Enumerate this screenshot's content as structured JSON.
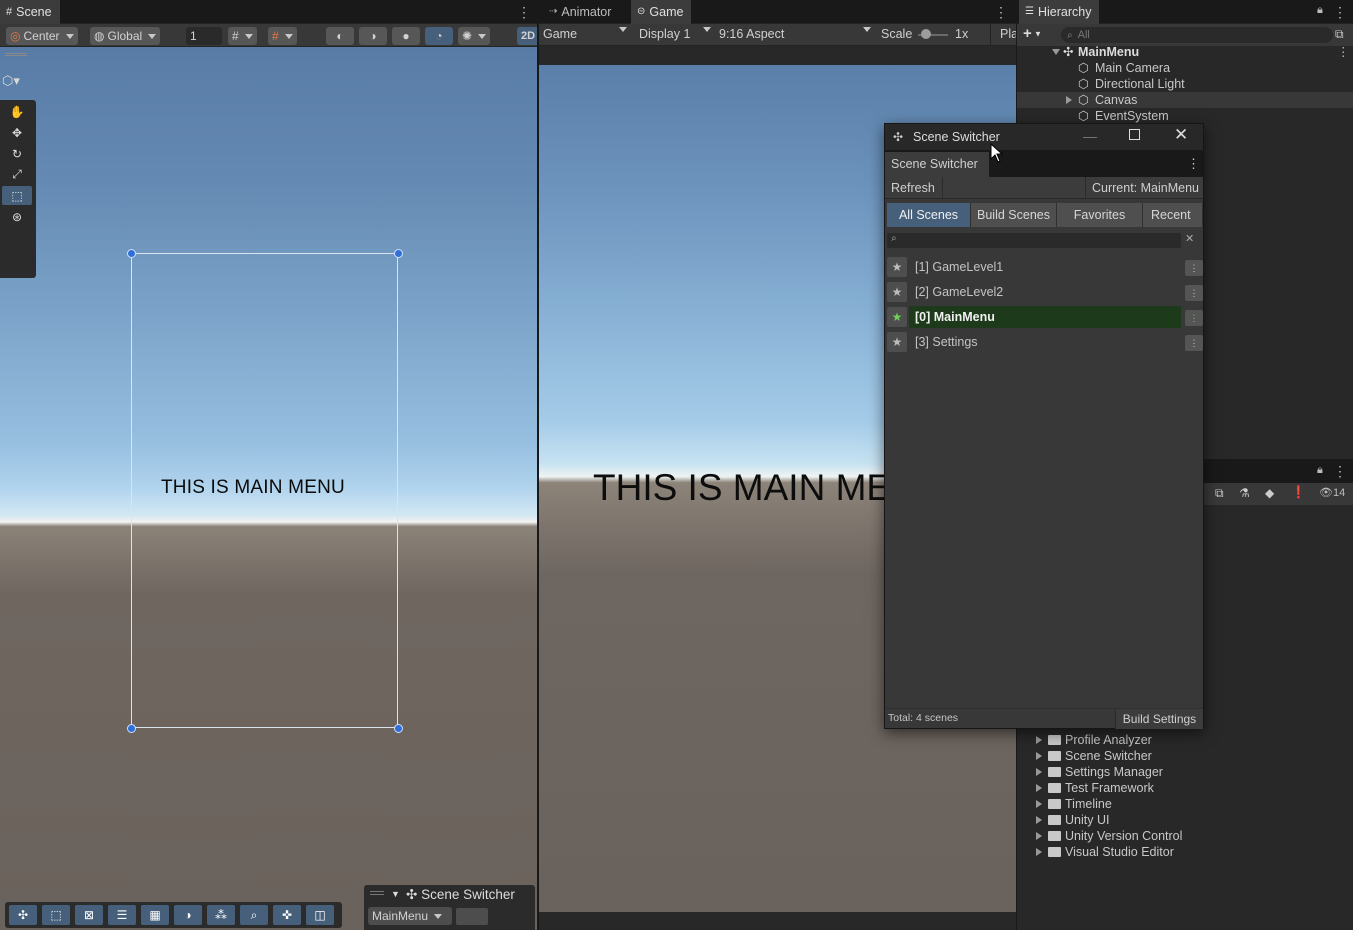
{
  "scene_panel": {
    "tab_label": "Scene",
    "toolbar": {
      "pivot": "Center",
      "space": "Global",
      "snap_value": "1",
      "mode_2d": "2D"
    },
    "canvas_text": "THIS IS MAIN MENU"
  },
  "game_panel": {
    "tabs": [
      {
        "label": "Animator"
      },
      {
        "label": "Game"
      }
    ],
    "toolbar": {
      "view_mode": "Game",
      "display": "Display 1",
      "aspect": "9:16 Aspect",
      "scale_label": "Scale",
      "scale_value": "1x",
      "play_label": "Pla"
    },
    "canvas_text": "THIS IS MAIN MENU"
  },
  "hierarchy": {
    "tab_label": "Hierarchy",
    "search_placeholder": "All",
    "items": [
      {
        "label": "MainMenu"
      },
      {
        "label": "Main Camera"
      },
      {
        "label": "Directional Light"
      },
      {
        "label": "Canvas"
      },
      {
        "label": "EventSystem"
      }
    ],
    "hidden_count": "14"
  },
  "project_packages": [
    {
      "label": "Profile Analyzer"
    },
    {
      "label": "Scene Switcher"
    },
    {
      "label": "Settings Manager"
    },
    {
      "label": "Test Framework"
    },
    {
      "label": "Timeline"
    },
    {
      "label": "Unity UI"
    },
    {
      "label": "Unity Version Control"
    },
    {
      "label": "Visual Studio Editor"
    }
  ],
  "scene_switcher_window": {
    "window_title": "Scene Switcher",
    "tab_label": "Scene Switcher",
    "refresh_label": "Refresh",
    "current_label": "Current: MainMenu",
    "filters": [
      {
        "label": "All Scenes"
      },
      {
        "label": "Build Scenes"
      },
      {
        "label": "Favorites"
      },
      {
        "label": "Recent"
      }
    ],
    "search_value": "",
    "scenes": [
      {
        "label": "[1] GameLevel1",
        "current": false
      },
      {
        "label": "[2] GameLevel2",
        "current": false
      },
      {
        "label": "[0] MainMenu",
        "current": true
      },
      {
        "label": "[3] Settings",
        "current": false
      }
    ],
    "total_label": "Total: 4 scenes",
    "build_settings_label": "Build Settings"
  },
  "scene_overlay": {
    "title": "Scene Switcher",
    "selected_scene": "MainMenu"
  },
  "colors": {
    "accent": "#46607c",
    "current_row": "#1d3a1a",
    "panel": "#383838",
    "background": "#191919"
  }
}
